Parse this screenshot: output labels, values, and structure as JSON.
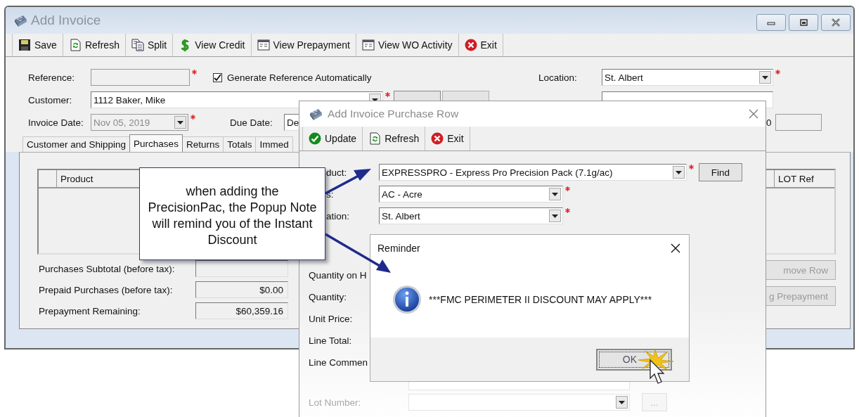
{
  "main_window": {
    "title": "Add Invoice",
    "toolbar": [
      {
        "kind": "save",
        "label": "Save"
      },
      {
        "kind": "refresh",
        "label": "Refresh"
      },
      {
        "kind": "split",
        "label": "Split"
      },
      {
        "kind": "credit",
        "label": "View Credit"
      },
      {
        "kind": "report",
        "label": "View Prepayment"
      },
      {
        "kind": "report",
        "label": "View WO Activity"
      },
      {
        "kind": "exit",
        "label": "Exit"
      }
    ],
    "reference": {
      "label": "Reference:",
      "disabled": true,
      "required": true
    },
    "generate_reference": {
      "label": "Generate Reference Automatically",
      "checked": true
    },
    "customer": {
      "label": "Customer:",
      "value": "1112 Baker, Mike",
      "required": true
    },
    "invoice_date": {
      "label": "Invoice Date:",
      "value": "Nov 05, 2019",
      "disabled": true,
      "required": true
    },
    "due_date": {
      "label": "Due Date:",
      "value": "De"
    },
    "location": {
      "label": "Location:",
      "value": "St. Albert",
      "required": true
    },
    "partial_text": "0",
    "tabs": [
      {
        "label": "Customer and Shipping",
        "selected": false
      },
      {
        "label": "Purchases",
        "selected": true
      },
      {
        "label": "Returns",
        "selected": false
      },
      {
        "label": "Totals",
        "selected": false
      },
      {
        "label": "Immed",
        "selected": false
      }
    ],
    "grid": {
      "columns": [
        "Product",
        "LOT Ref"
      ]
    },
    "side_buttons": [
      "move Row",
      "g Prepayment"
    ],
    "totals": [
      {
        "label": "Purchases Subtotal (before tax):"
      },
      {
        "label": "Prepaid Purchases (before tax):",
        "value": "$0.00"
      },
      {
        "label": "Prepayment Remaining:",
        "value": "$60,359.16"
      }
    ]
  },
  "purchase_row_window": {
    "title": "Add Invoice Purchase Row",
    "toolbar": [
      {
        "kind": "update",
        "label": "Update"
      },
      {
        "kind": "refresh",
        "label": "Refresh"
      },
      {
        "kind": "exit",
        "label": "Exit"
      }
    ],
    "upper_fields": [
      {
        "label": "duct:",
        "value": "EXPRESSPRO - Express Pro Precision Pack (7.1g/ac)",
        "required": true,
        "button": "Find"
      },
      {
        "label": "s:",
        "value": "AC - Acre",
        "required": true
      },
      {
        "label": "ation:",
        "value": "St. Albert",
        "required": true
      }
    ],
    "lower_fields": [
      {
        "kind": "label",
        "label": "Quantity on H"
      },
      {
        "kind": "label",
        "label": "Quantity:"
      },
      {
        "kind": "label",
        "label": "Unit Price:"
      },
      {
        "kind": "label",
        "label": "Line Total:"
      },
      {
        "kind": "comment",
        "label": "Line Commen"
      },
      {
        "kind": "combo",
        "label": "Lot Number:",
        "button": "..."
      }
    ]
  },
  "reminder": {
    "title": "Reminder",
    "message": "***FMC PERIMETER II DISCOUNT MAY APPLY***",
    "button": "OK"
  },
  "callout": {
    "text": "when adding the PrecisionPac, the Popup Note will remind you of the Instant Discount"
  }
}
